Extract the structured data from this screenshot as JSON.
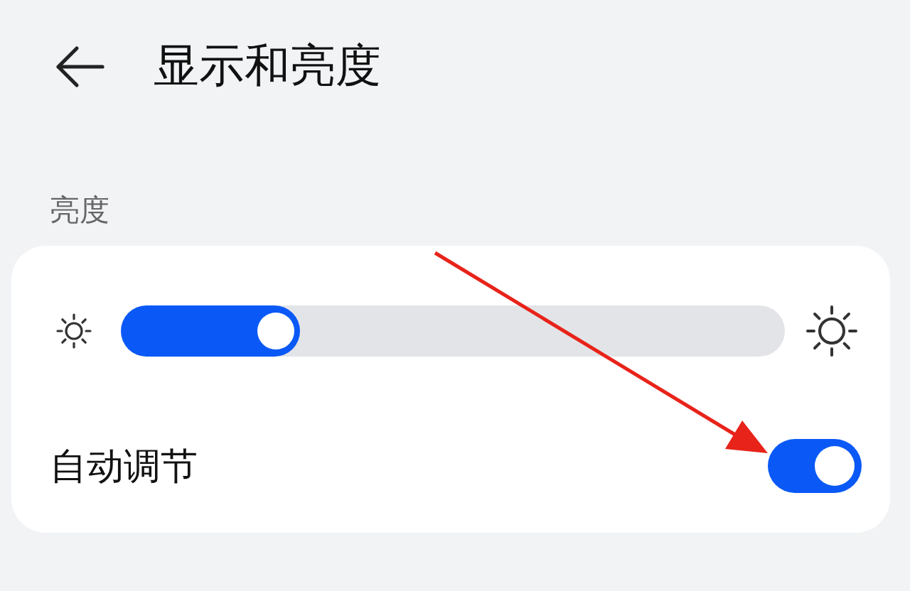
{
  "header": {
    "title": "显示和亮度"
  },
  "section": {
    "label": "亮度"
  },
  "brightness": {
    "level": 0.27
  },
  "auto_adjust": {
    "label": "自动调节",
    "on": true
  }
}
